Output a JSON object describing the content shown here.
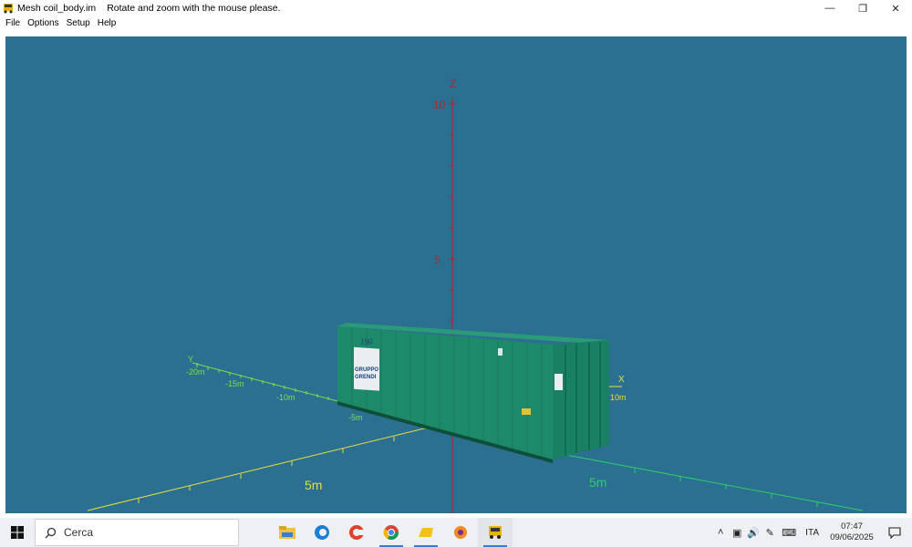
{
  "window": {
    "title": "Mesh coil_body.im",
    "hint": "Rotate and zoom with the mouse please.",
    "minimize_icon": "minimize-icon",
    "restore_icon": "restore-icon",
    "close_icon": "close-icon"
  },
  "menu": {
    "items": [
      "File",
      "Options",
      "Setup",
      "Help"
    ]
  },
  "viewport": {
    "background": "#2b6f91",
    "axes": {
      "z": {
        "label": "Z",
        "ticks": [
          "10",
          "5"
        ],
        "color": "#b0262e"
      },
      "y": {
        "label": "Y",
        "ticks": [
          "-20m",
          "-15m",
          "-10m",
          "-5m"
        ],
        "color": "#7ee04a"
      },
      "x": {
        "label": "X",
        "ticks": [
          "10m"
        ],
        "color": "#e6e03a"
      },
      "floor_labels": [
        "5m",
        "5m"
      ]
    },
    "model": {
      "color": "#1d8a6a",
      "logo_lines": [
        "190",
        "GRUPPO",
        "GRENDI"
      ]
    }
  },
  "taskbar": {
    "search_placeholder": "Cerca",
    "apps": [
      "file-explorer-icon",
      "edge-icon",
      "ccleaner-icon",
      "chrome-icon",
      "folder-app-icon",
      "viewer-app-icon",
      "truck-app-icon"
    ],
    "language": "ITA",
    "time": "07:47",
    "date": "09/06/2025"
  }
}
